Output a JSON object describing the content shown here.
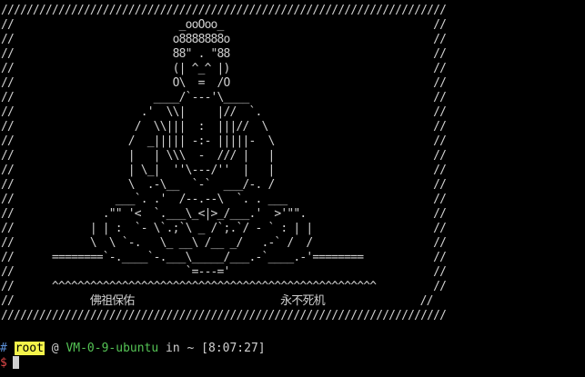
{
  "terminal": {
    "banner_lines": [
      "//////////////////////////////////////////////////////////////////////",
      "//                          _ooOoo_                                 //",
      "//                         o8888888o                                //",
      "//                         88\" . \"88                                //",
      "//                         (| ^_^ |)                                //",
      "//                         O\\  =  /O                                //",
      "//                      ____/`---'\\____                             //",
      "//                    .'  \\\\|     |//  `.                           //",
      "//                   /  \\\\|||  :  |||//  \\                          //",
      "//                  /  _||||| -:- |||||-  \\                         //",
      "//                  |   | \\\\\\  -  /// |   |                         //",
      "//                  | \\_|  ''\\---/''  |   |                         //",
      "//                  \\  .-\\__  `-`  ___/-. /                         //",
      "//                ___`. .'  /--.--\\  `. . ___                       //",
      "//              .\"\" '<  `.___\\_<|>_/___.'  >'\"\".                    //",
      "//            | | :  `- \\`.;`\\ _ /`;.`/ - ` : | |                   //",
      "//            \\  \\ `-.   \\_ __\\ /__ _/   .-` /  /                   //",
      "//      ========`-.____`-.___\\_____/___.-`____.-'========           //",
      "//                           `=---='                                //",
      "//      ^^^^^^^^^^^^^^^^^^^^^^^^^^^^^^^^^^^^^^^^^^^^^^^^^^^         //",
      "//            佛祖保佑                       永不死机               //",
      "//////////////////////////////////////////////////////////////////////"
    ],
    "prompt": {
      "hash": "#",
      "user": "root",
      "at": "@",
      "host": "VM-0-9-ubuntu",
      "in_label": "in",
      "dir": "~",
      "time": "[8:07:27]",
      "dollar": "$"
    },
    "colors": {
      "background": "#000000",
      "foreground": "#d0d0d0",
      "hash": "#5b8fd6",
      "user_highlight": "#f3f34a",
      "host": "#55c455",
      "dollar": "#e04848"
    }
  }
}
